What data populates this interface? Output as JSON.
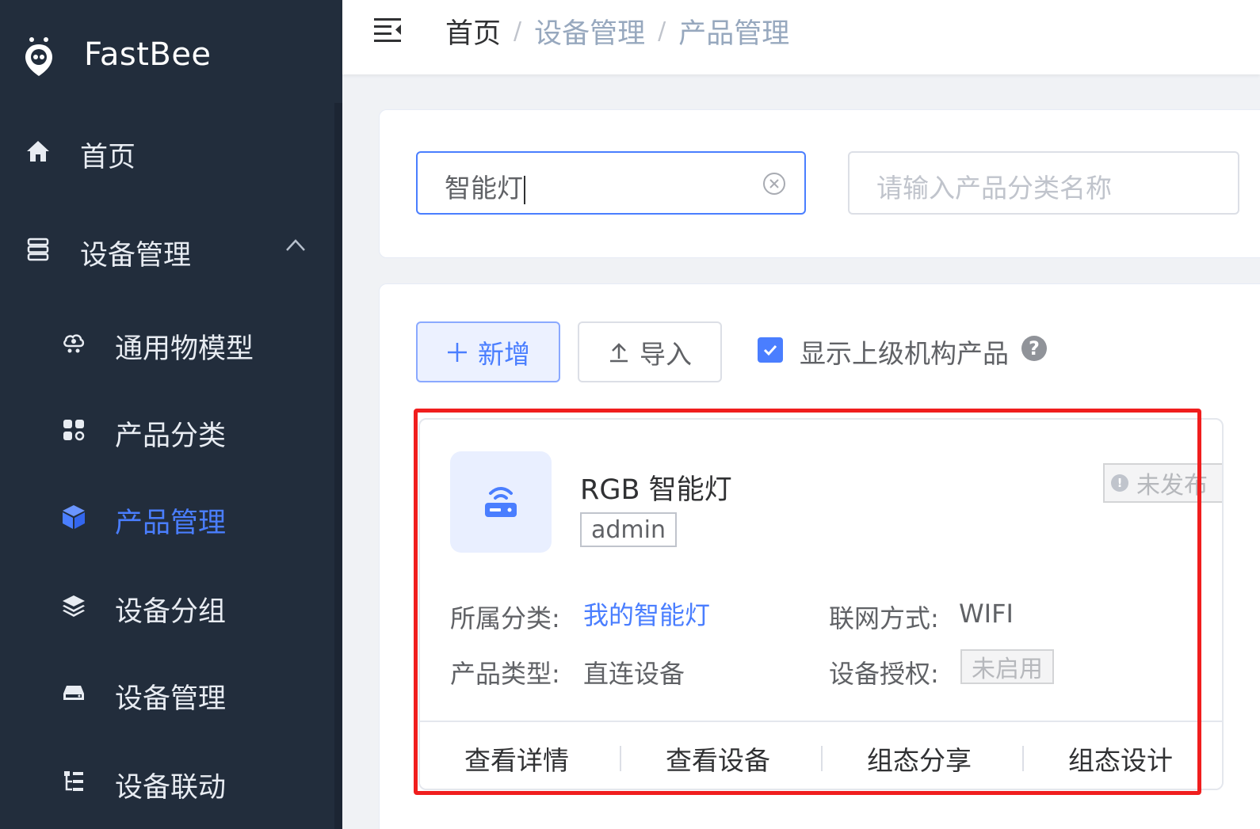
{
  "app": {
    "name": "FastBee"
  },
  "sidebar": {
    "items": [
      {
        "label": "首页",
        "icon": "home-icon"
      },
      {
        "label": "设备管理",
        "icon": "server-icon",
        "expanded": true
      },
      {
        "label": "通用物模型",
        "icon": "cloud-icon"
      },
      {
        "label": "产品分类",
        "icon": "apps-icon"
      },
      {
        "label": "产品管理",
        "icon": "cube-icon",
        "active": true
      },
      {
        "label": "设备分组",
        "icon": "layers-icon"
      },
      {
        "label": "设备管理",
        "icon": "device-icon"
      },
      {
        "label": "设备联动",
        "icon": "tree-icon"
      }
    ]
  },
  "breadcrumb": {
    "home": "首页",
    "level1": "设备管理",
    "level2": "产品管理",
    "separator": "/"
  },
  "search": {
    "product_name_value": "智能灯",
    "category_placeholder": "请输入产品分类名称"
  },
  "toolbar": {
    "add_label": "新增",
    "import_label": "导入",
    "show_parent_label": "显示上级机构产品",
    "show_parent_checked": true
  },
  "product": {
    "name": "RGB 智能灯",
    "owner_tag": "admin",
    "status": "未发布",
    "category_label": "所属分类:",
    "category_value": "我的智能灯",
    "network_label": "联网方式:",
    "network_value": "WIFI",
    "type_label": "产品类型:",
    "type_value": "直连设备",
    "auth_label": "设备授权:",
    "auth_value": "未启用",
    "actions": [
      "查看详情",
      "查看设备",
      "组态分享",
      "组态设计"
    ]
  },
  "colors": {
    "sidebar_bg": "#222d3c",
    "accent": "#4a7eff",
    "highlight": "#f01e1e"
  }
}
